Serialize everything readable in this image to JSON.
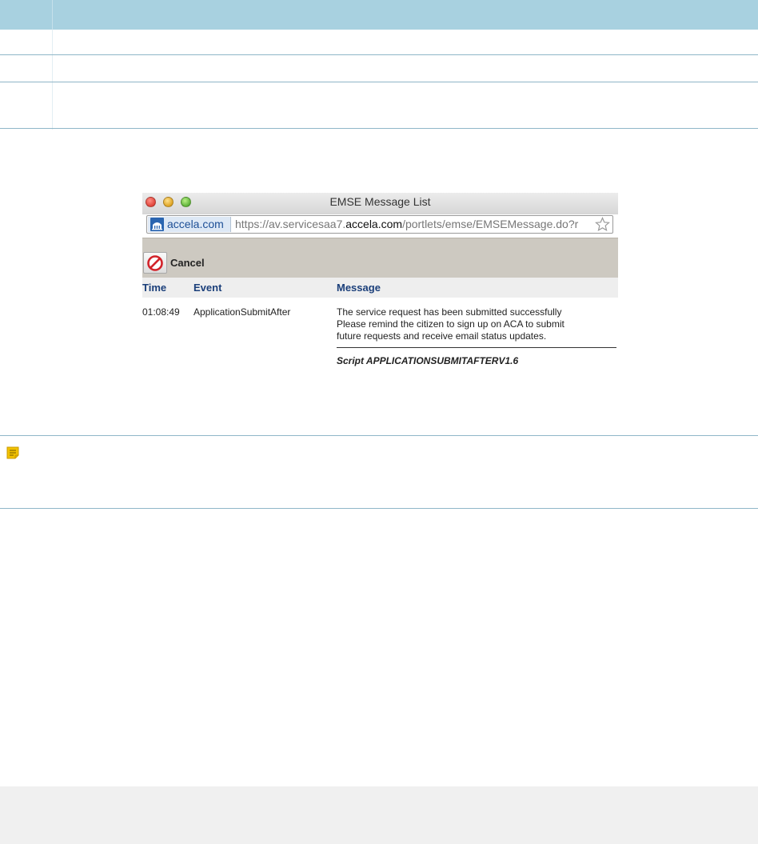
{
  "window": {
    "title": "EMSE Message List",
    "site_name": "accela.com",
    "url_prefix": "https://av.servicesaa7.",
    "url_domain": "accela.com",
    "url_suffix": "/portlets/emse/EMSEMessage.do?r"
  },
  "toolbar": {
    "cancel_label": "Cancel"
  },
  "message_table": {
    "columns": [
      "Time",
      "Event",
      "Message"
    ],
    "rows": [
      {
        "time": "01:08:49",
        "event": "ApplicationSubmitAfter",
        "message_lines": [
          "The service request has been submitted successfully",
          "Please remind the citizen to sign up on ACA to submit",
          "future requests and receive email status updates."
        ],
        "script": "Script  APPLICATIONSUBMITAFTERV1.6"
      }
    ]
  },
  "icons": {
    "close": "close-dot-icon",
    "minimize": "minimize-dot-icon",
    "zoom": "zoom-dot-icon",
    "site": "accela-logo-icon",
    "bookmark": "star-icon",
    "cancel": "no-entry-icon",
    "note": "note-icon"
  },
  "colors": {
    "table_header": "#a8d1e0",
    "table_rule": "#8fb6c8",
    "toolbar": "#cdc9c1",
    "column_header_text": "#1b3f7a",
    "note_icon": "#f2c200"
  }
}
